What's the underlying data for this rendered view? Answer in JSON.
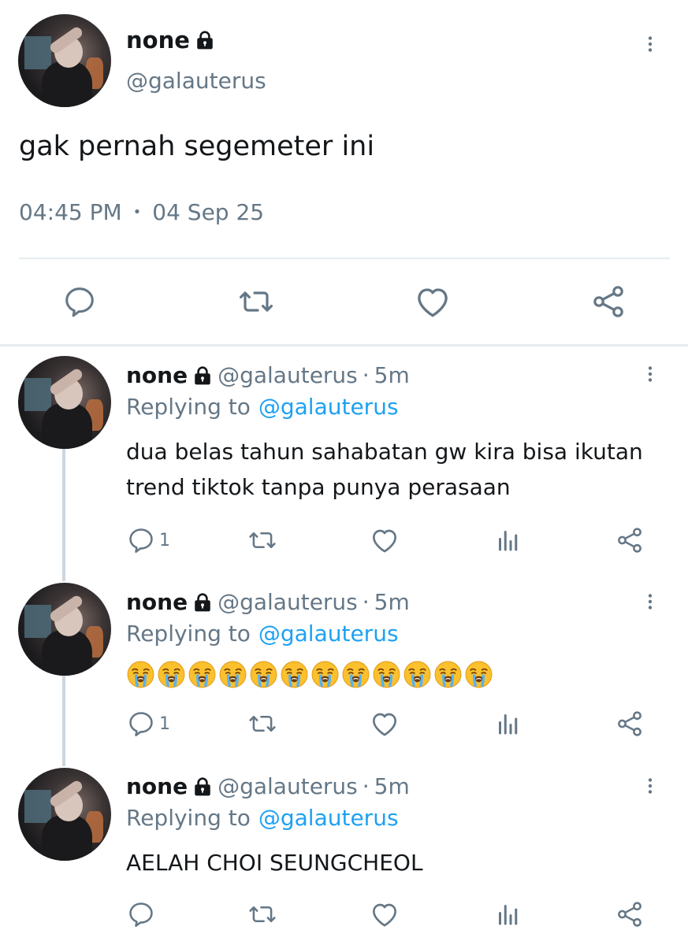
{
  "main_tweet": {
    "name": "none",
    "handle": "@galauterus",
    "text": "gak pernah segemeter ini",
    "time": "04:45 PM",
    "separator": "•",
    "date": "04 Sep 25"
  },
  "replies": [
    {
      "name": "none",
      "handle": "@galauterus",
      "dot": "·",
      "age": "5m",
      "replying_prefix": "Replying to",
      "replying_to": "@galauterus",
      "text_line1": "dua belas tahun sahabatan gw kira bisa ikutan",
      "text_line2": "trend tiktok tanpa punya perasaan",
      "reply_count": "1"
    },
    {
      "name": "none",
      "handle": "@galauterus",
      "dot": "·",
      "age": "5m",
      "replying_prefix": "Replying to",
      "replying_to": "@galauterus",
      "emoji_count": 12,
      "emoji_icon": "loudly-crying-face",
      "reply_count": "1"
    },
    {
      "name": "none",
      "handle": "@galauterus",
      "dot": "·",
      "age": "5m",
      "replying_prefix": "Replying to",
      "replying_to": "@galauterus",
      "text_line1": "AELAH CHOI SEUNGCHEOL",
      "reply_count": ""
    }
  ],
  "colors": {
    "text": "#14171a",
    "muted": "#657786",
    "link": "#1da1f2",
    "divider": "#e6ecf0",
    "thread_line": "#ccd6dd"
  }
}
